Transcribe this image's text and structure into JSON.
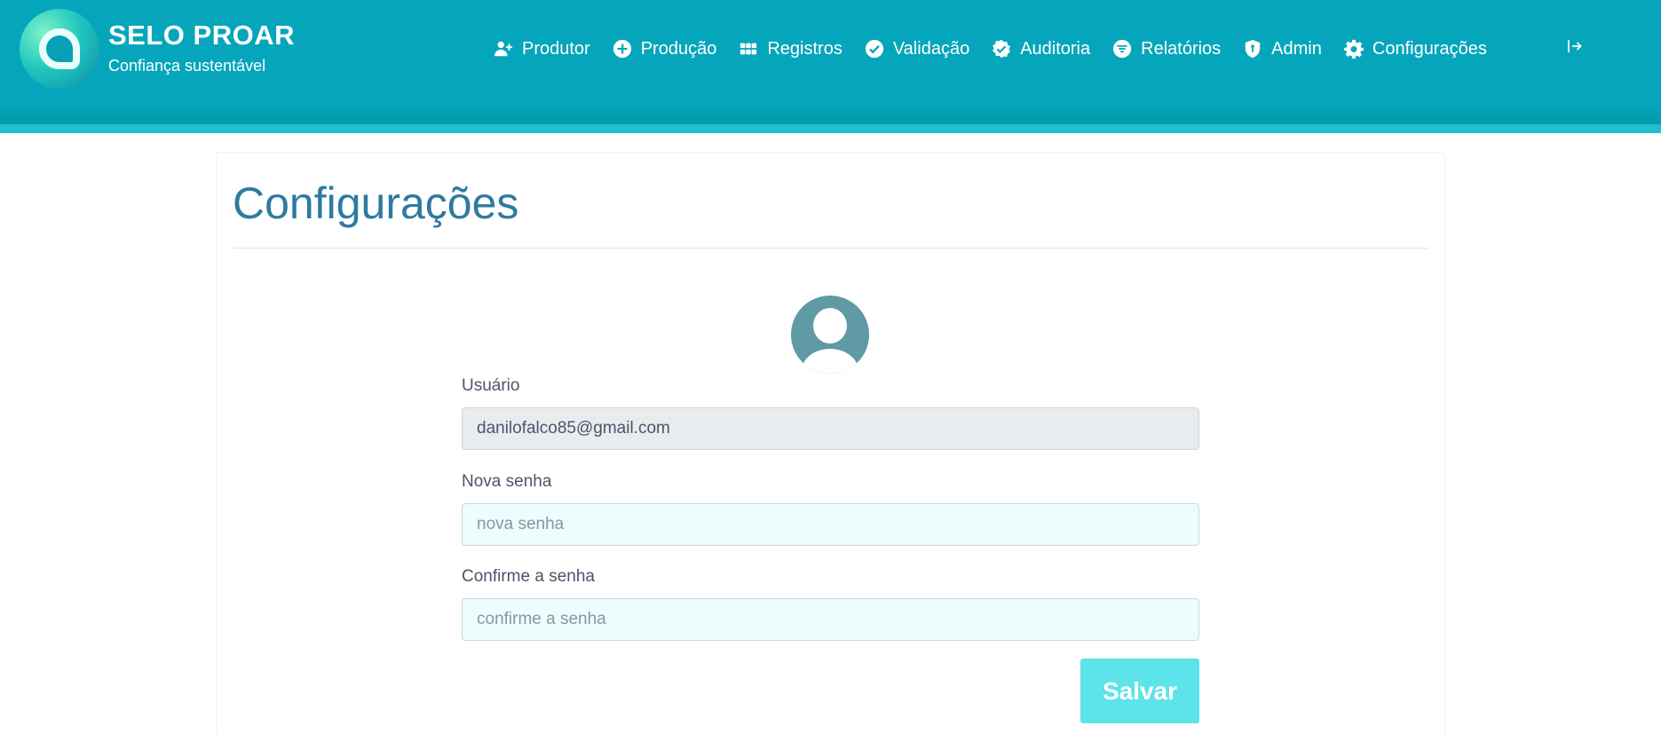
{
  "brand": {
    "title": "SELO PROAR",
    "subtitle": "Confiança sustentável"
  },
  "nav": {
    "items": [
      {
        "label": "Produtor",
        "icon": "user-plus-icon"
      },
      {
        "label": "Produção",
        "icon": "plus-circle-icon"
      },
      {
        "label": "Registros",
        "icon": "grid-icon"
      },
      {
        "label": "Validação",
        "icon": "check-circle-icon"
      },
      {
        "label": "Auditoria",
        "icon": "badge-check-icon"
      },
      {
        "label": "Relatórios",
        "icon": "filter-circle-icon"
      },
      {
        "label": "Admin",
        "icon": "shield-icon"
      },
      {
        "label": "Configurações",
        "icon": "gear-icon"
      }
    ],
    "logout_icon": "logout-icon"
  },
  "page": {
    "title": "Configurações"
  },
  "form": {
    "user_label": "Usuário",
    "user_value": "danilofalco85@gmail.com",
    "new_password_label": "Nova senha",
    "new_password_placeholder": "nova senha",
    "confirm_password_label": "Confirme a senha",
    "confirm_password_placeholder": "confirme a senha",
    "save_label": "Salvar"
  },
  "colors": {
    "header": "#05a6bb",
    "title": "#2e7aa0",
    "save_button": "#5de3ea",
    "avatar": "#5f9aa5"
  }
}
